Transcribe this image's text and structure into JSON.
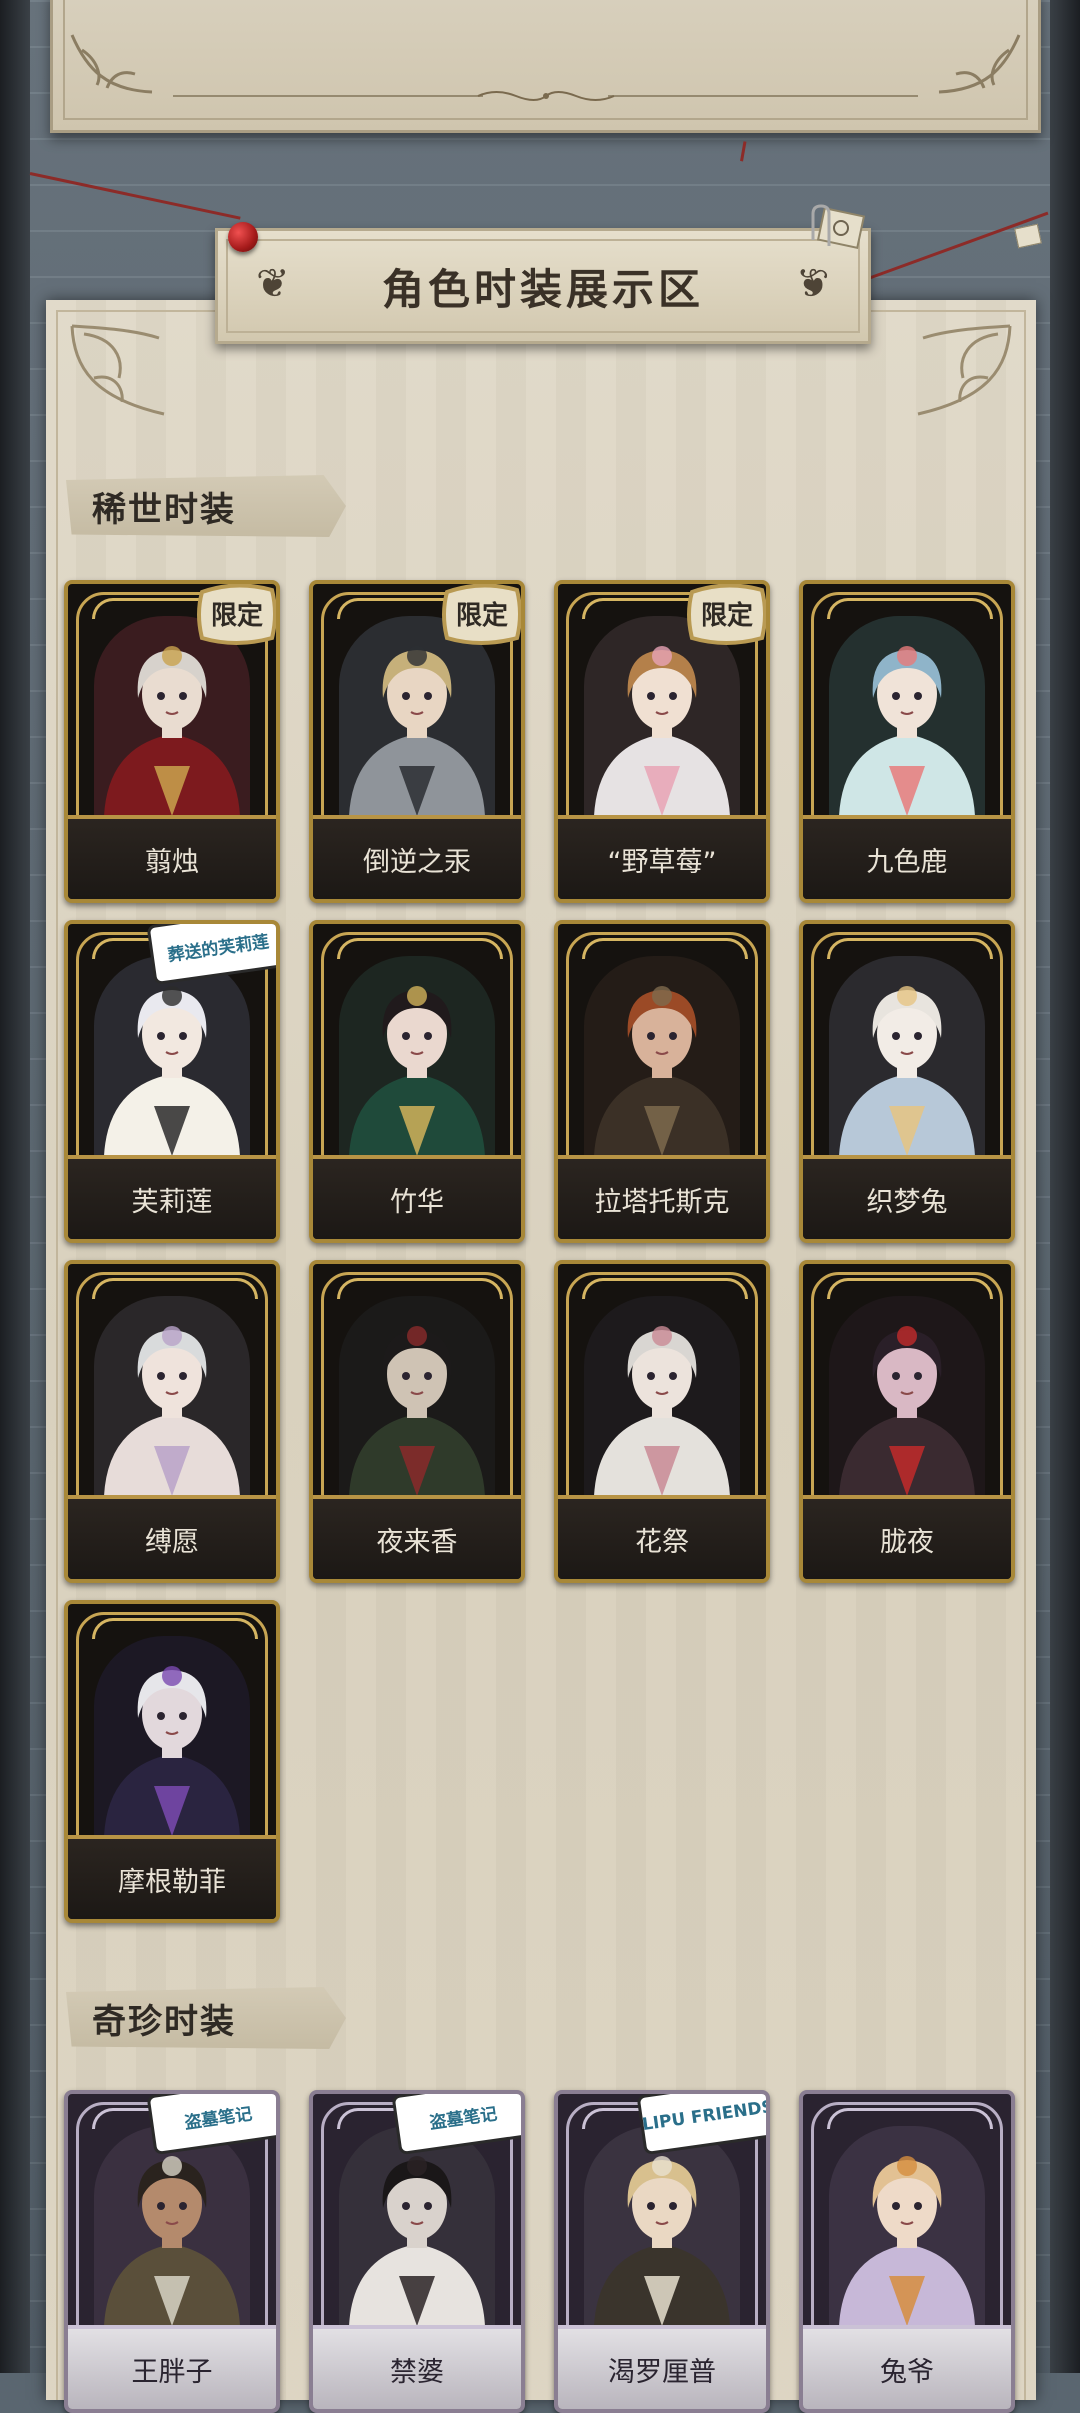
{
  "header": {
    "banner_title": "角色时装展示区"
  },
  "sections": [
    {
      "label": "稀世时装",
      "cards": [
        {
          "name": "翦烛",
          "tag": "限定",
          "skin": "#e9dcd0",
          "hair": "#d7d2cc",
          "outfit": "#7d1a1e",
          "accent": "#c9a34d",
          "bg": "#3a1c1f"
        },
        {
          "name": "倒逆之汞",
          "tag": "限定",
          "skin": "#e8d6c3",
          "hair": "#c6b07a",
          "outfit": "#8f949a",
          "accent": "#2c2e33",
          "bg": "#2b2d31"
        },
        {
          "name": "“野草莓”",
          "tag": "限定",
          "skin": "#f0e0d2",
          "hair": "#b4804a",
          "outfit": "#e6e2e3",
          "accent": "#e7a3b5",
          "bg": "#2e2626"
        },
        {
          "name": "九色鹿",
          "tag": "",
          "skin": "#f0e3d8",
          "hair": "#8fb4c9",
          "outfit": "#cfe6e6",
          "accent": "#e77b7b",
          "bg": "#24302f"
        },
        {
          "name": "芙莉莲",
          "tag": "葬送的芙莉莲",
          "skin": "#f2e8e0",
          "hair": "#e9e9ef",
          "outfit": "#f4f1e8",
          "accent": "#2a2a2a",
          "bg": "#2a2a30"
        },
        {
          "name": "竹华",
          "tag": "",
          "skin": "#ead8cf",
          "hair": "#201a1c",
          "outfit": "#1f4a3a",
          "accent": "#d1b25a",
          "bg": "#1d2621"
        },
        {
          "name": "拉塔托斯克",
          "tag": "",
          "skin": "#d8b29a",
          "hair": "#9b4a26",
          "outfit": "#3b3026",
          "accent": "#7e6a4e",
          "bg": "#241c17"
        },
        {
          "name": "织梦兔",
          "tag": "",
          "skin": "#f2ece6",
          "hair": "#e8e4de",
          "outfit": "#b7c8d8",
          "accent": "#e6c483",
          "bg": "#2b2a2e"
        },
        {
          "name": "缚愿",
          "tag": "",
          "skin": "#efe3dc",
          "hair": "#d9dbdc",
          "outfit": "#e7dcd9",
          "accent": "#b8a2c8",
          "bg": "#2a2729"
        },
        {
          "name": "夜来香",
          "tag": "",
          "skin": "#cfc3b4",
          "hair": "#1c1a1a",
          "outfit": "#2f3a2a",
          "accent": "#8a2a2a",
          "bg": "#1b1a19"
        },
        {
          "name": "花祭",
          "tag": "",
          "skin": "#ece3dc",
          "hair": "#d9d6d2",
          "outfit": "#e4e1dc",
          "accent": "#c98a95",
          "bg": "#1d1a1c"
        },
        {
          "name": "胧夜",
          "tag": "",
          "skin": "#d9b8c4",
          "hair": "#2a1f28",
          "outfit": "#3a2a30",
          "accent": "#c22a2a",
          "bg": "#1e1719"
        },
        {
          "name": "摩根勒菲",
          "tag": "",
          "skin": "#e2d8dc",
          "hair": "#e6e6ea",
          "outfit": "#2a2440",
          "accent": "#7a4ab0",
          "bg": "#1c1824"
        }
      ]
    },
    {
      "label": "奇珍时装",
      "cards": [
        {
          "name": "王胖子",
          "tag": "盗墓笔记",
          "skin": "#b48a6c",
          "hair": "#2a231e",
          "outfit": "#5a4f3a",
          "accent": "#d8d3c6",
          "bg": "#3a3040"
        },
        {
          "name": "禁婆",
          "tag": "盗墓笔记",
          "skin": "#d9d2cc",
          "hair": "#1a1718",
          "outfit": "#e7e3df",
          "accent": "#2a2326",
          "bg": "#35303a"
        },
        {
          "name": "渴罗厘普",
          "tag": "LIPU FRIENDS",
          "skin": "#ead8c3",
          "hair": "#d8c08e",
          "outfit": "#3a342c",
          "accent": "#e8e0cf",
          "bg": "#3a3340"
        },
        {
          "name": "兔爷",
          "tag": "",
          "skin": "#eedac8",
          "hair": "#e2c193",
          "outfit": "#c7b8d8",
          "accent": "#d68d3f",
          "bg": "#3b3243"
        }
      ]
    }
  ]
}
